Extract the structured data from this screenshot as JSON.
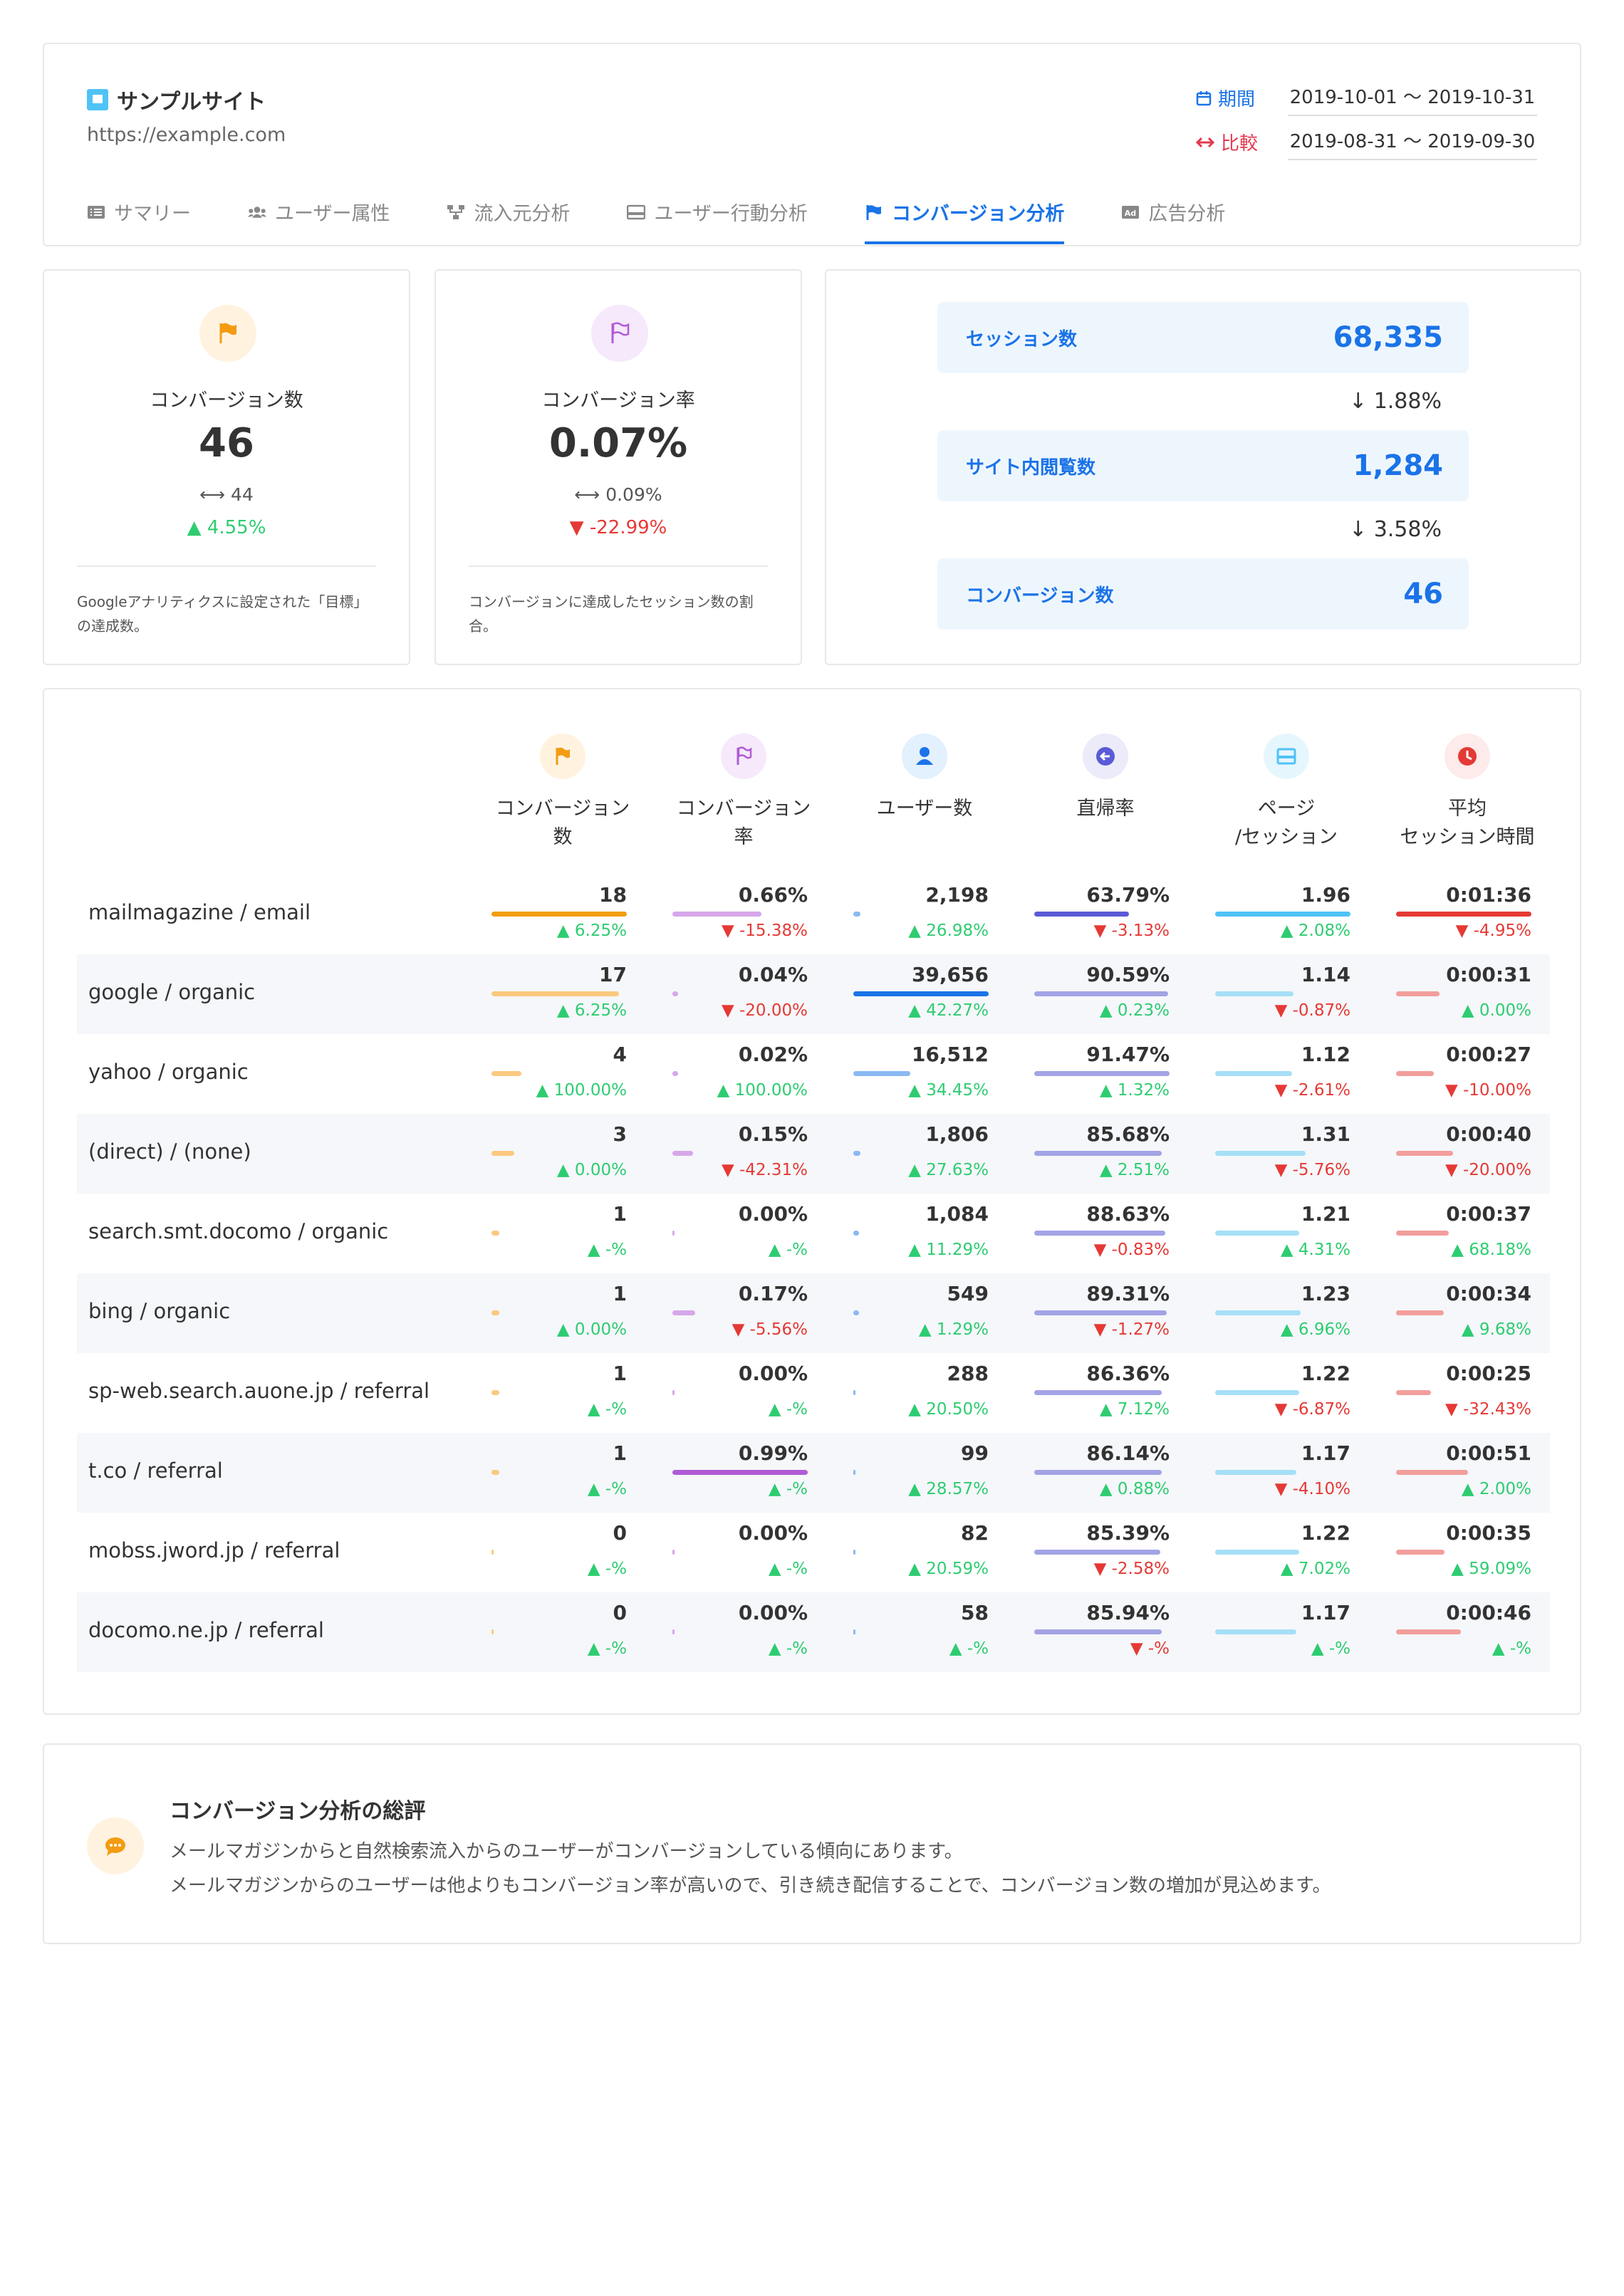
{
  "header": {
    "site_name": "サンプルサイト",
    "site_url": "https://example.com",
    "period_label": "期間",
    "period_value": "2019-10-01 〜 2019-10-31",
    "compare_label": "比較",
    "compare_value": "2019-08-31 〜 2019-09-30",
    "tabs": [
      {
        "label": "サマリー",
        "icon": "list-icon"
      },
      {
        "label": "ユーザー属性",
        "icon": "users-icon"
      },
      {
        "label": "流入元分析",
        "icon": "sitemap-icon"
      },
      {
        "label": "ユーザー行動分析",
        "icon": "window-icon"
      },
      {
        "label": "コンバージョン分析",
        "icon": "flag-icon",
        "active": true
      },
      {
        "label": "広告分析",
        "icon": "ad-icon"
      }
    ]
  },
  "kpis": {
    "conversions": {
      "title": "コンバージョン数",
      "value": "46",
      "previous": "44",
      "change": "4.55%",
      "direction": "up",
      "description": "Googleアナリティクスに設定された「目標」の達成数。"
    },
    "conversion_rate": {
      "title": "コンバージョン率",
      "value": "0.07%",
      "previous": "0.09%",
      "change": "-22.99%",
      "direction": "down",
      "description": "コンバージョンに達成したセッション数の割合。"
    }
  },
  "funnel": {
    "steps": [
      {
        "label": "セッション数",
        "value": "68,335"
      },
      {
        "label": "サイト内閲覧数",
        "value": "1,284"
      },
      {
        "label": "コンバージョン数",
        "value": "46"
      }
    ],
    "drops": [
      "1.88%",
      "3.58%"
    ]
  },
  "table": {
    "columns": [
      {
        "label": "コンバージョン\n数",
        "icon": "flag-icon",
        "color": "#f39c12",
        "bg": "#fff3e0"
      },
      {
        "label": "コンバージョン\n率",
        "icon": "flag-outline-icon",
        "color": "#b05bd6",
        "bg": "#f6e9fb"
      },
      {
        "label": "ユーザー数",
        "icon": "user-icon",
        "color": "#1a73e8",
        "bg": "#e3f0fd"
      },
      {
        "label": "直帰率",
        "icon": "arrow-left-circle-icon",
        "color": "#5a5bd6",
        "bg": "#ebebfa"
      },
      {
        "label": "ページ\n/セッション",
        "icon": "window-icon",
        "color": "#4fc3f7",
        "bg": "#e6f6fd"
      },
      {
        "label": "平均\nセッション時間",
        "icon": "clock-icon",
        "color": "#e53935",
        "bg": "#fdeaea"
      }
    ],
    "rows": [
      {
        "label": "mailmagazine / email",
        "cells": [
          {
            "value": "18",
            "change": "6.25%",
            "dir": "up",
            "bar": 1.0,
            "strong": true
          },
          {
            "value": "0.66%",
            "change": "-15.38%",
            "dir": "down",
            "bar": 0.66
          },
          {
            "value": "2,198",
            "change": "26.98%",
            "dir": "up",
            "bar": 0.05
          },
          {
            "value": "63.79%",
            "change": "-3.13%",
            "dir": "down",
            "bar": 0.7,
            "strong": true
          },
          {
            "value": "1.96",
            "change": "2.08%",
            "dir": "up",
            "bar": 1.0,
            "strong": true
          },
          {
            "value": "0:01:36",
            "change": "-4.95%",
            "dir": "down",
            "bar": 1.0,
            "strong": true
          }
        ]
      },
      {
        "label": "google / organic",
        "cells": [
          {
            "value": "17",
            "change": "6.25%",
            "dir": "up",
            "bar": 0.94
          },
          {
            "value": "0.04%",
            "change": "-20.00%",
            "dir": "down",
            "bar": 0.04
          },
          {
            "value": "39,656",
            "change": "42.27%",
            "dir": "up",
            "bar": 1.0,
            "strong": true
          },
          {
            "value": "90.59%",
            "change": "0.23%",
            "dir": "up",
            "bar": 0.99
          },
          {
            "value": "1.14",
            "change": "-0.87%",
            "dir": "down",
            "bar": 0.58
          },
          {
            "value": "0:00:31",
            "change": "0.00%",
            "dir": "up",
            "bar": 0.32
          }
        ]
      },
      {
        "label": "yahoo / organic",
        "cells": [
          {
            "value": "4",
            "change": "100.00%",
            "dir": "up",
            "bar": 0.22
          },
          {
            "value": "0.02%",
            "change": "100.00%",
            "dir": "up",
            "bar": 0.02
          },
          {
            "value": "16,512",
            "change": "34.45%",
            "dir": "up",
            "bar": 0.42
          },
          {
            "value": "91.47%",
            "change": "1.32%",
            "dir": "up",
            "bar": 1.0
          },
          {
            "value": "1.12",
            "change": "-2.61%",
            "dir": "down",
            "bar": 0.57
          },
          {
            "value": "0:00:27",
            "change": "-10.00%",
            "dir": "down",
            "bar": 0.28
          }
        ]
      },
      {
        "label": "(direct) / (none)",
        "cells": [
          {
            "value": "3",
            "change": "0.00%",
            "dir": "up",
            "bar": 0.17
          },
          {
            "value": "0.15%",
            "change": "-42.31%",
            "dir": "down",
            "bar": 0.15
          },
          {
            "value": "1,806",
            "change": "27.63%",
            "dir": "up",
            "bar": 0.05
          },
          {
            "value": "85.68%",
            "change": "2.51%",
            "dir": "up",
            "bar": 0.94
          },
          {
            "value": "1.31",
            "change": "-5.76%",
            "dir": "down",
            "bar": 0.67
          },
          {
            "value": "0:00:40",
            "change": "-20.00%",
            "dir": "down",
            "bar": 0.42
          }
        ]
      },
      {
        "label": "search.smt.docomo / organic",
        "cells": [
          {
            "value": "1",
            "change": "-%",
            "dir": "up",
            "bar": 0.06
          },
          {
            "value": "0.00%",
            "change": "-%",
            "dir": "up",
            "bar": 0.0
          },
          {
            "value": "1,084",
            "change": "11.29%",
            "dir": "up",
            "bar": 0.03
          },
          {
            "value": "88.63%",
            "change": "-0.83%",
            "dir": "down",
            "bar": 0.97
          },
          {
            "value": "1.21",
            "change": "4.31%",
            "dir": "up",
            "bar": 0.62
          },
          {
            "value": "0:00:37",
            "change": "68.18%",
            "dir": "up",
            "bar": 0.39
          }
        ]
      },
      {
        "label": "bing / organic",
        "cells": [
          {
            "value": "1",
            "change": "0.00%",
            "dir": "up",
            "bar": 0.06
          },
          {
            "value": "0.17%",
            "change": "-5.56%",
            "dir": "down",
            "bar": 0.17
          },
          {
            "value": "549",
            "change": "1.29%",
            "dir": "up",
            "bar": 0.01
          },
          {
            "value": "89.31%",
            "change": "-1.27%",
            "dir": "down",
            "bar": 0.98
          },
          {
            "value": "1.23",
            "change": "6.96%",
            "dir": "up",
            "bar": 0.63
          },
          {
            "value": "0:00:34",
            "change": "9.68%",
            "dir": "up",
            "bar": 0.35
          }
        ]
      },
      {
        "label": "sp-web.search.auone.jp / referral",
        "cells": [
          {
            "value": "1",
            "change": "-%",
            "dir": "up",
            "bar": 0.06
          },
          {
            "value": "0.00%",
            "change": "-%",
            "dir": "up",
            "bar": 0.0
          },
          {
            "value": "288",
            "change": "20.50%",
            "dir": "up",
            "bar": 0.0
          },
          {
            "value": "86.36%",
            "change": "7.12%",
            "dir": "up",
            "bar": 0.94
          },
          {
            "value": "1.22",
            "change": "-6.87%",
            "dir": "down",
            "bar": 0.62
          },
          {
            "value": "0:00:25",
            "change": "-32.43%",
            "dir": "down",
            "bar": 0.26
          }
        ]
      },
      {
        "label": "t.co / referral",
        "cells": [
          {
            "value": "1",
            "change": "-%",
            "dir": "up",
            "bar": 0.06
          },
          {
            "value": "0.99%",
            "change": "-%",
            "dir": "up",
            "bar": 1.0,
            "strong": true
          },
          {
            "value": "99",
            "change": "28.57%",
            "dir": "up",
            "bar": 0.0
          },
          {
            "value": "86.14%",
            "change": "0.88%",
            "dir": "up",
            "bar": 0.94
          },
          {
            "value": "1.17",
            "change": "-4.10%",
            "dir": "down",
            "bar": 0.6
          },
          {
            "value": "0:00:51",
            "change": "2.00%",
            "dir": "up",
            "bar": 0.53
          }
        ]
      },
      {
        "label": "mobss.jword.jp / referral",
        "cells": [
          {
            "value": "0",
            "change": "-%",
            "dir": "up",
            "bar": 0.0
          },
          {
            "value": "0.00%",
            "change": "-%",
            "dir": "up",
            "bar": 0.0
          },
          {
            "value": "82",
            "change": "20.59%",
            "dir": "up",
            "bar": 0.0
          },
          {
            "value": "85.39%",
            "change": "-2.58%",
            "dir": "down",
            "bar": 0.93
          },
          {
            "value": "1.22",
            "change": "7.02%",
            "dir": "up",
            "bar": 0.62
          },
          {
            "value": "0:00:35",
            "change": "59.09%",
            "dir": "up",
            "bar": 0.36
          }
        ]
      },
      {
        "label": "docomo.ne.jp / referral",
        "cells": [
          {
            "value": "0",
            "change": "-%",
            "dir": "up",
            "bar": 0.0
          },
          {
            "value": "0.00%",
            "change": "-%",
            "dir": "up",
            "bar": 0.0
          },
          {
            "value": "58",
            "change": "-%",
            "dir": "up",
            "bar": 0.0
          },
          {
            "value": "85.94%",
            "change": "-%",
            "dir": "down",
            "bar": 0.94
          },
          {
            "value": "1.17",
            "change": "-%",
            "dir": "up",
            "bar": 0.6
          },
          {
            "value": "0:00:46",
            "change": "-%",
            "dir": "up",
            "bar": 0.48
          }
        ]
      }
    ]
  },
  "summary": {
    "title": "コンバージョン分析の総評",
    "line1": "メールマガジンからと自然検索流入からのユーザーがコンバージョンしている傾向にあります。",
    "line2": "メールマガジンからのユーザーは他よりもコンバージョン率が高いので、引き続き配信することで、コンバージョン数の増加が見込めます。"
  },
  "colors": {
    "accent": "#1a73e8",
    "up": "#2ecc71",
    "down": "#e53935"
  }
}
